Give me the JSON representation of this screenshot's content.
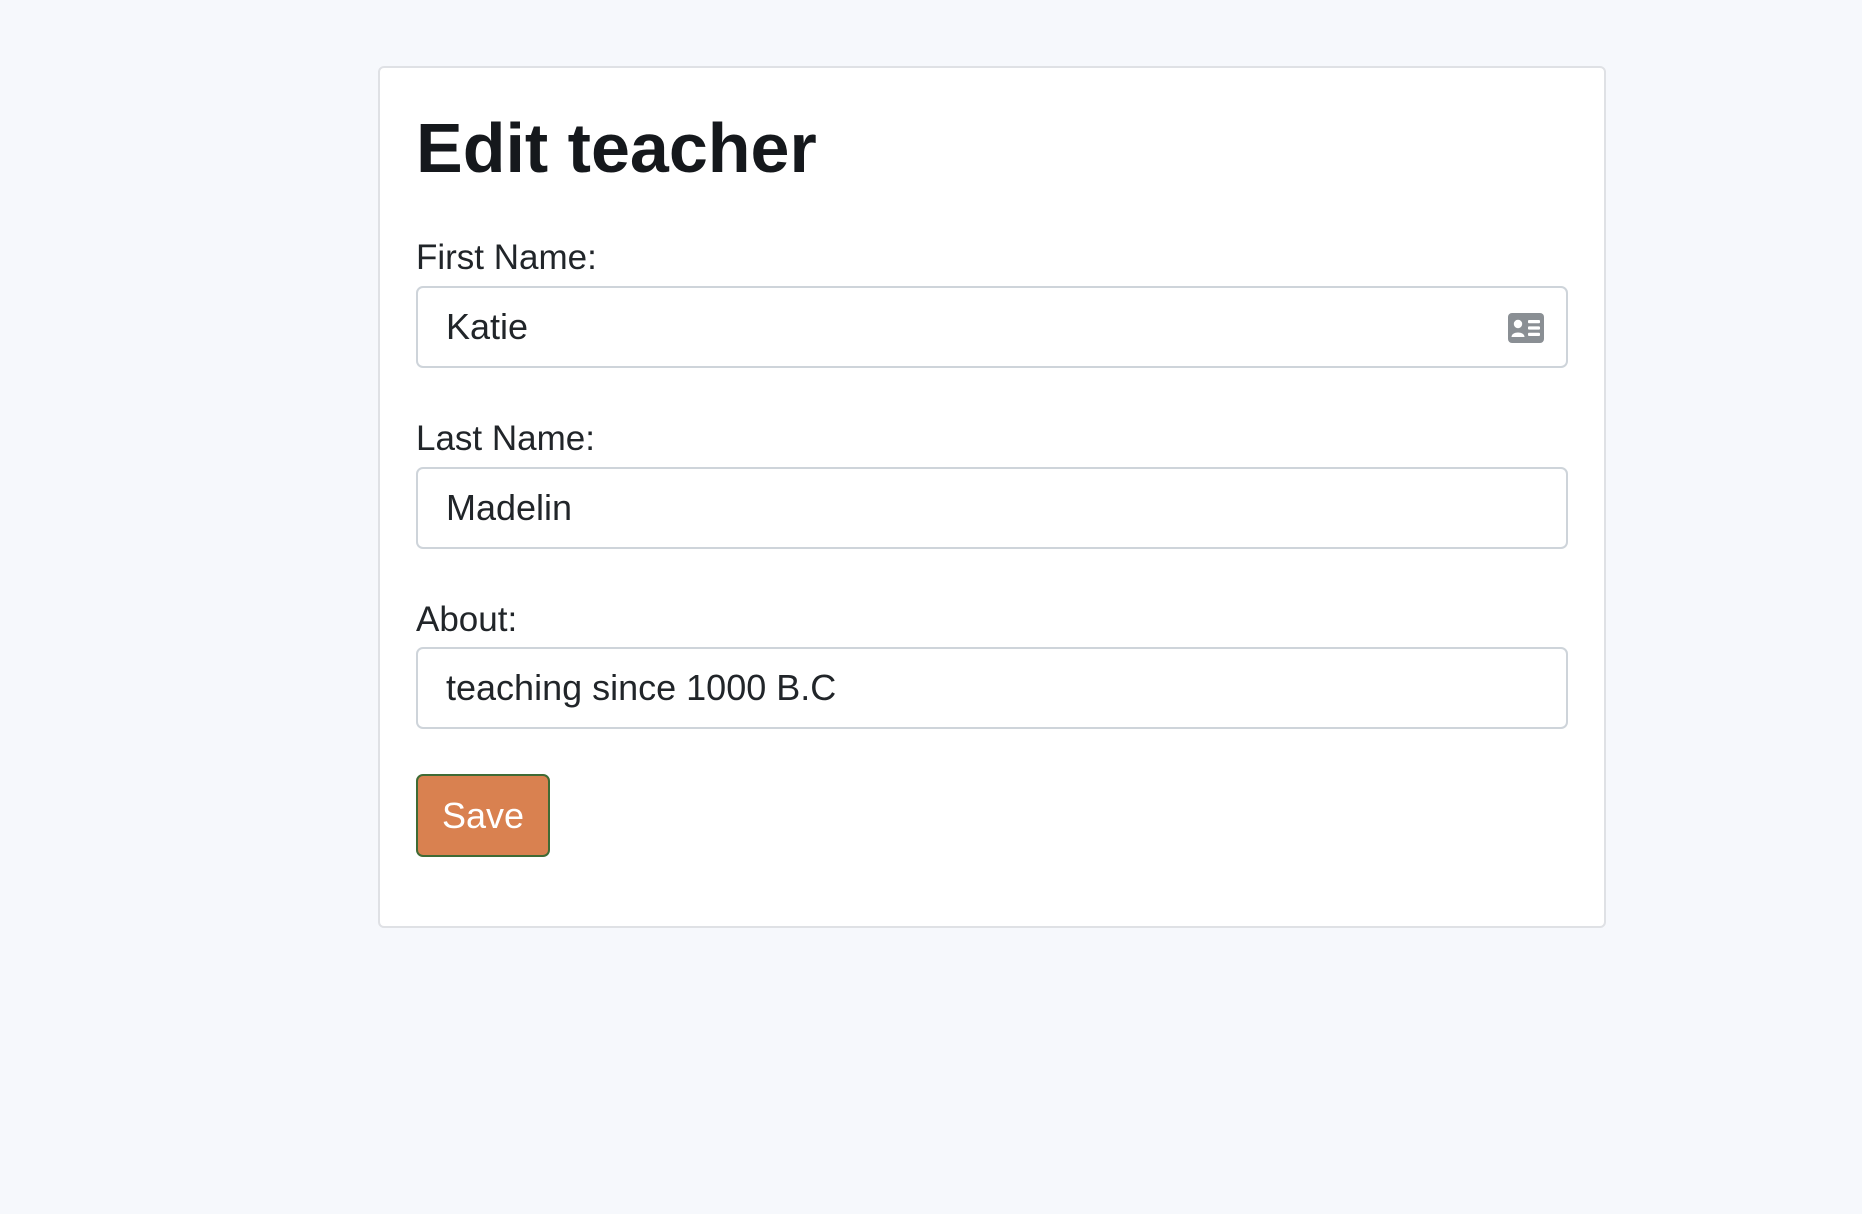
{
  "page": {
    "title": "Edit teacher"
  },
  "form": {
    "first_name": {
      "label": "First Name:",
      "value": "Katie",
      "icon": "contact-card-icon"
    },
    "last_name": {
      "label": "Last Name:",
      "value": "Madelin"
    },
    "about": {
      "label": "About:",
      "value": "teaching since 1000 B.C"
    },
    "save_label": "Save"
  },
  "colors": {
    "background": "#f6f8fc",
    "card": "#ffffff",
    "save_button": "#d98150",
    "save_button_border": "#3f6b35",
    "input_border": "#ced4da"
  }
}
